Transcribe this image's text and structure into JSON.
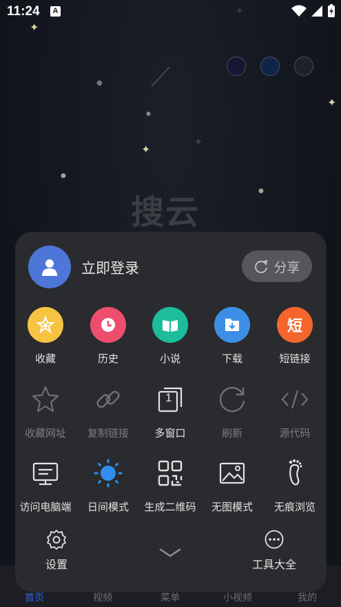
{
  "status_bar": {
    "time": "11:24",
    "a_badge": "A"
  },
  "home": {
    "logo_text": "搜云"
  },
  "bottom_nav": {
    "items": [
      "首页",
      "视频",
      "菜单",
      "小视频",
      "我的"
    ]
  },
  "menu": {
    "login_label": "立即登录",
    "share_label": "分享",
    "row1": [
      {
        "label": "收藏",
        "icon": "star-icon",
        "color": "#f6c343"
      },
      {
        "label": "历史",
        "icon": "clock-icon",
        "color": "#ee4d6e"
      },
      {
        "label": "小说",
        "icon": "book-icon",
        "color": "#1cbc9c"
      },
      {
        "label": "下载",
        "icon": "download-icon",
        "color": "#3d8fe6"
      },
      {
        "label": "短链接",
        "icon": "short-link-icon",
        "color": "#f4662c",
        "glyph": "短"
      }
    ],
    "row2": [
      {
        "label": "收藏网址",
        "icon": "star-outline-icon",
        "enabled": false
      },
      {
        "label": "复制链接",
        "icon": "link-icon",
        "enabled": false
      },
      {
        "label": "多窗口",
        "icon": "windows-icon",
        "enabled": true,
        "badge": "1"
      },
      {
        "label": "刷新",
        "icon": "refresh-icon",
        "enabled": false
      },
      {
        "label": "源代码",
        "icon": "code-icon",
        "enabled": false
      }
    ],
    "row3": [
      {
        "label": "访问电脑端",
        "icon": "monitor-icon"
      },
      {
        "label": "日间模式",
        "icon": "sun-icon"
      },
      {
        "label": "生成二维码",
        "icon": "qrcode-icon"
      },
      {
        "label": "无图模式",
        "icon": "image-icon"
      },
      {
        "label": "无痕浏览",
        "icon": "footprint-icon"
      }
    ],
    "footer": {
      "settings_label": "设置",
      "tools_label": "工具大全"
    }
  }
}
